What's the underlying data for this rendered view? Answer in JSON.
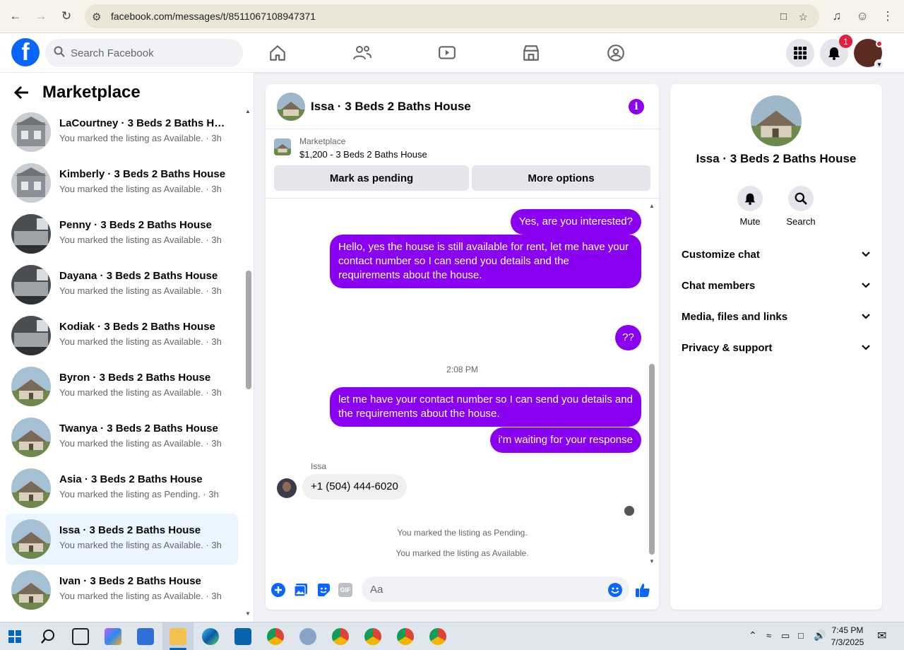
{
  "browser": {
    "url": "facebook.com/messages/t/8511067108947371"
  },
  "fb_header": {
    "search_placeholder": "Search Facebook",
    "notification_count": "1"
  },
  "sidebar": {
    "title": "Marketplace",
    "conversations": [
      {
        "name": "LaCourtney · 3 Beds 2 Baths Hou...",
        "status": "You marked the listing as Available. · 3h",
        "thumb": "gray"
      },
      {
        "name": "Kimberly · 3 Beds 2 Baths House",
        "status": "You marked the listing as Available. · 3h",
        "thumb": "gray"
      },
      {
        "name": "Penny · 3 Beds 2 Baths House",
        "status": "You marked the listing as Available. · 3h",
        "thumb": "dark"
      },
      {
        "name": "Dayana · 3 Beds 2 Baths House",
        "status": "You marked the listing as Available. · 3h",
        "thumb": "dark"
      },
      {
        "name": "Kodiak · 3 Beds 2 Baths House",
        "status": "You marked the listing as Available. · 3h",
        "thumb": "dark"
      },
      {
        "name": "Byron · 3 Beds 2 Baths House",
        "status": "You marked the listing as Available. · 3h",
        "thumb": "house"
      },
      {
        "name": "Twanya · 3 Beds 2 Baths House",
        "status": "You marked the listing as Available. · 3h",
        "thumb": "house"
      },
      {
        "name": "Asia · 3 Beds 2 Baths House",
        "status": "You marked the listing as Pending. · 3h",
        "thumb": "house"
      },
      {
        "name": "Issa · 3 Beds 2 Baths House",
        "status": "You marked the listing as Available. · 3h",
        "thumb": "house",
        "active": true
      },
      {
        "name": "Ivan · 3 Beds 2 Baths House",
        "status": "You marked the listing as Available. · 3h",
        "thumb": "house"
      }
    ]
  },
  "chat": {
    "title": "Issa · 3 Beds 2 Baths House",
    "listing_label": "Marketplace",
    "listing_price": "$1,200 - 3 Beds 2 Baths House",
    "mark_pending_label": "Mark as pending",
    "more_options_label": "More options",
    "messages": {
      "m1": "Yes, are you interested?",
      "m2": "Hello, yes the house is still available for rent, let me have your contact number so I can send you details and the requirements about the house.",
      "m3": "??",
      "timestamp": "2:08 PM",
      "m4": "let me have your contact number so I can send you details and the requirements about the house.",
      "m5": "i'm waiting for your response",
      "sender_name": "Issa",
      "m6": "+1 (504) 444-6020",
      "event1": "You marked the listing as Pending.",
      "event2": "You marked the listing as Available."
    },
    "composer_placeholder": "Aa",
    "gif_label": "GIF"
  },
  "details": {
    "title": "Issa · 3 Beds 2 Baths House",
    "mute_label": "Mute",
    "search_label": "Search",
    "rows": [
      "Customize chat",
      "Chat members",
      "Media, files and links",
      "Privacy & support"
    ]
  },
  "taskbar": {
    "time": "7:45 PM",
    "date": "7/3/2025"
  },
  "colors": {
    "accent": "#8a00f0",
    "fb_blue": "#0866ff",
    "active_row": "#ebf5ff"
  }
}
